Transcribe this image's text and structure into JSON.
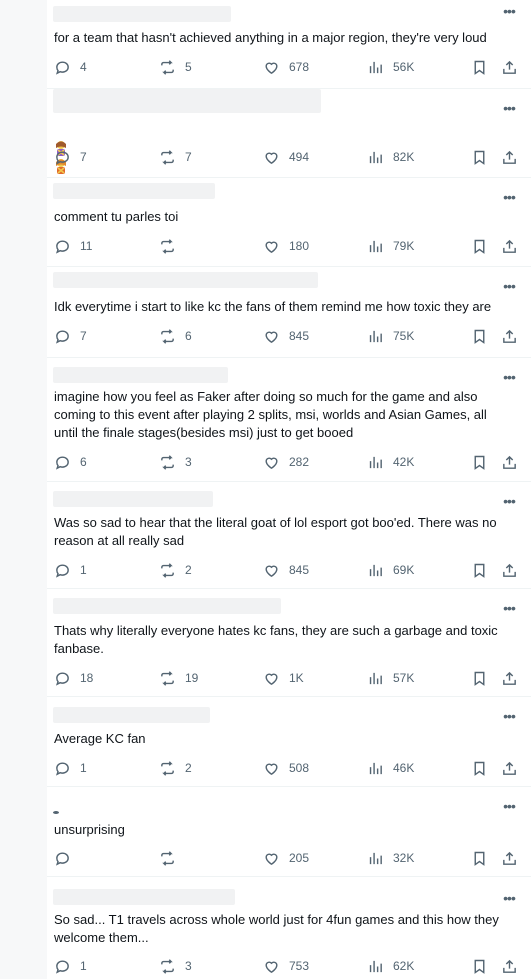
{
  "posts": [
    {
      "text": "for a team that hasn't achieved anything in a major region, they're very loud",
      "replies": "4",
      "reposts": "5",
      "likes": "678",
      "views": "56K"
    },
    {
      "text": "",
      "emoji": [
        "person-gesturing-no",
        "person-gesturing-no"
      ],
      "replies": "7",
      "reposts": "7",
      "likes": "494",
      "views": "82K"
    },
    {
      "text": "comment tu parles toi",
      "replies": "11",
      "reposts": "",
      "likes": "180",
      "views": "79K"
    },
    {
      "text": "Idk everytime i start to like kc the fans of them remind me how toxic they are",
      "replies": "7",
      "reposts": "6",
      "likes": "845",
      "views": "75K"
    },
    {
      "text": "imagine how you feel as Faker after doing so much for the game and also\ncoming to this event after playing 2 splits, msi, worlds and Asian Games, all\nuntil the finale stages(besides msi) just to get booed",
      "replies": "6",
      "reposts": "3",
      "likes": "282",
      "views": "42K"
    },
    {
      "text": "Was so sad to hear that the literal goat of lol esport got boo'ed. There was no\nreason at all really sad",
      "replies": "1",
      "reposts": "2",
      "likes": "845",
      "views": "69K"
    },
    {
      "text": "Thats why literally everyone hates kc fans, they are such a garbage and toxic\nfanbase.",
      "replies": "18",
      "reposts": "19",
      "likes": "1K",
      "views": "57K"
    },
    {
      "text": "Average KC fan",
      "replies": "1",
      "reposts": "2",
      "likes": "508",
      "views": "46K"
    },
    {
      "text": "unsurprising",
      "replies": "",
      "reposts": "",
      "likes": "205",
      "views": "32K"
    },
    {
      "text": "So sad... T1 travels across whole world just for 4fun games and this how they\nwelcome them...",
      "replies": "1",
      "reposts": "3",
      "likes": "753",
      "views": "62K"
    }
  ],
  "icons": {
    "more": "more-icon",
    "reply": "reply-icon",
    "repost": "repost-icon",
    "like": "heart-icon",
    "views": "views-icon",
    "bookmark": "bookmark-icon",
    "share": "share-icon"
  },
  "colors": {
    "icon": "#536471",
    "text": "#0f1419",
    "divider": "#eff3f4"
  }
}
